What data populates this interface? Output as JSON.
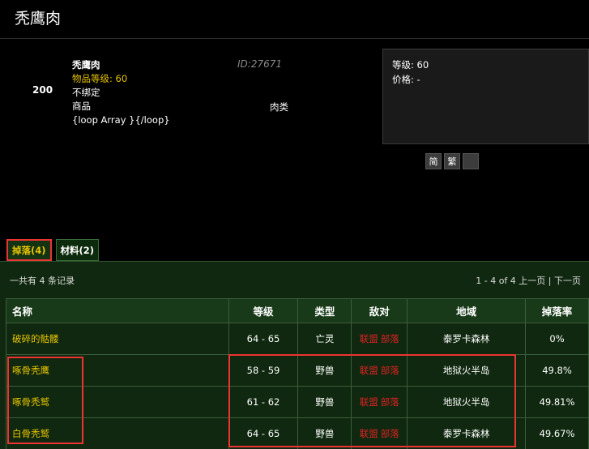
{
  "page": {
    "title": "秃鹰肉"
  },
  "item": {
    "number": "200",
    "name": "秃鹰肉",
    "item_level": "物品等级: 60",
    "binding": "不绑定",
    "kind": "商品",
    "loop_text": "{loop Array }{/loop}",
    "db_id": "ID:27671",
    "category": "肉类"
  },
  "info_panel": {
    "level": "等级: 60",
    "price": "价格: -"
  },
  "lang_buttons": [
    "简",
    "繁",
    ""
  ],
  "tabs": [
    {
      "label": "掉落(4)",
      "active": true
    },
    {
      "label": "材料(2)",
      "active": false
    }
  ],
  "drops": {
    "summary": "一共有 4 条记录",
    "pager": "1 - 4 of 4 上一页 | 下一页",
    "columns": [
      "名称",
      "等级",
      "类型",
      "敌对",
      "地域",
      "掉落率"
    ],
    "rows": [
      {
        "name": "破碎的骷髅",
        "level": "64 - 65",
        "type": "亡灵",
        "hostile_a": "联盟",
        "hostile_b": "部落",
        "zone": "泰罗卡森林",
        "rate": "0%"
      },
      {
        "name": "啄骨秃鹰",
        "level": "58 - 59",
        "type": "野兽",
        "hostile_a": "联盟",
        "hostile_b": "部落",
        "zone": "地狱火半岛",
        "rate": "49.8%"
      },
      {
        "name": "啄骨秃鹫",
        "level": "61 - 62",
        "type": "野兽",
        "hostile_a": "联盟",
        "hostile_b": "部落",
        "zone": "地狱火半岛",
        "rate": "49.81%"
      },
      {
        "name": "白骨秃鹫",
        "level": "64 - 65",
        "type": "野兽",
        "hostile_a": "联盟",
        "hostile_b": "部落",
        "zone": "泰罗卡森林",
        "rate": "49.67%"
      }
    ]
  },
  "colors": {
    "accent_yellow": "#e8c300",
    "hostile_red": "#d22",
    "panel_green": "#0f280f",
    "highlight_red": "#e33"
  }
}
